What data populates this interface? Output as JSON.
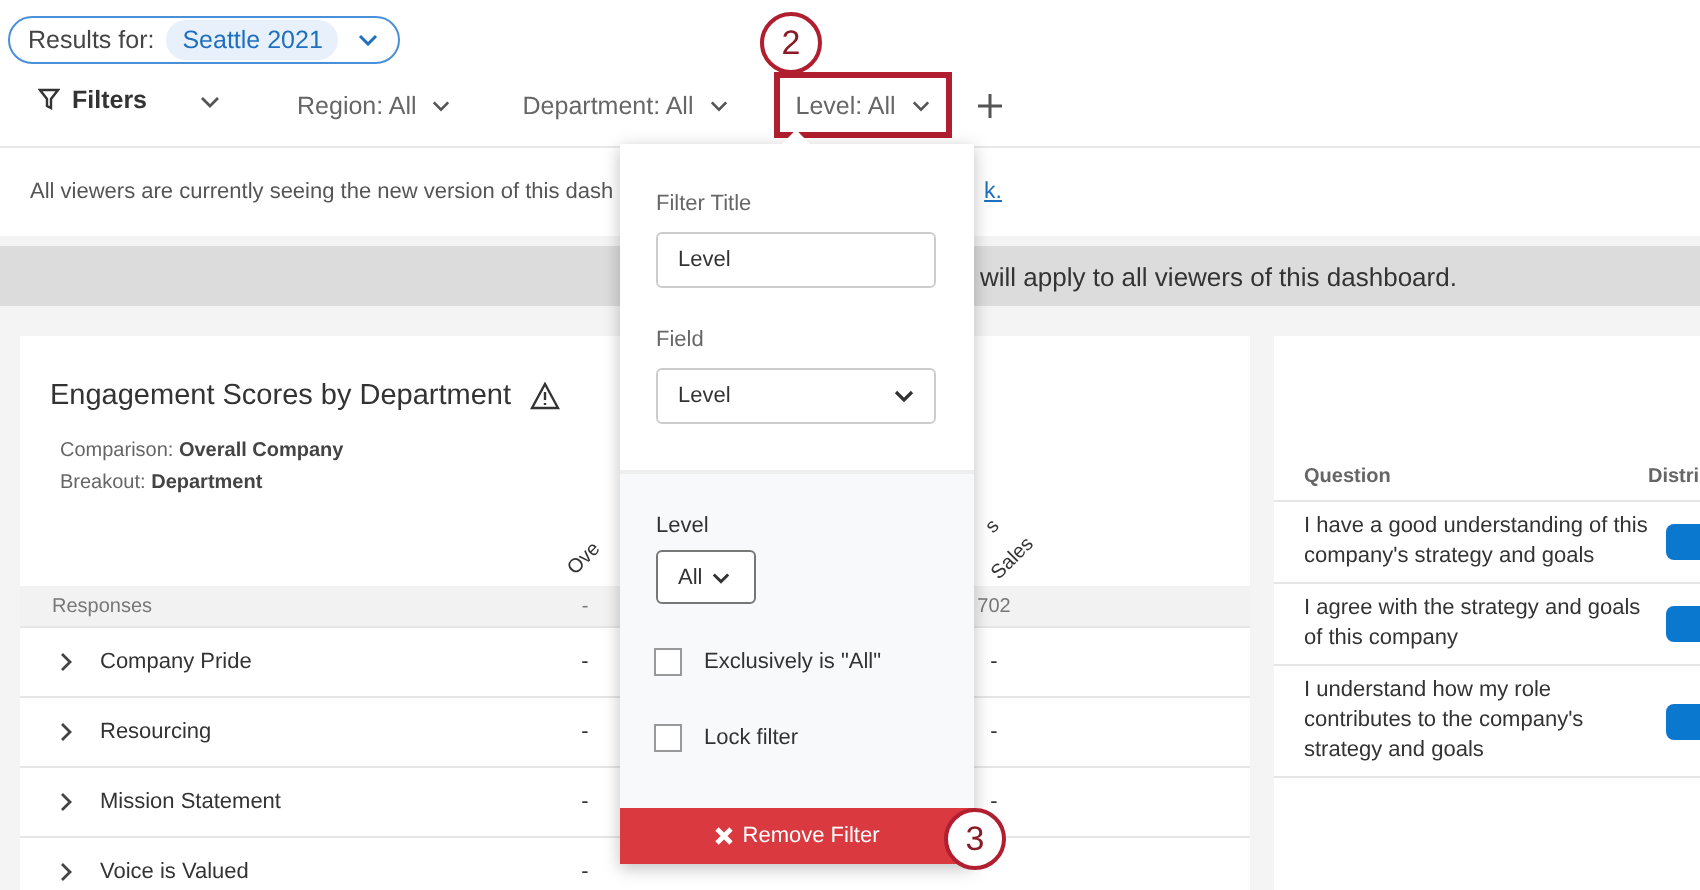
{
  "results_for": {
    "label": "Results for:",
    "value": "Seattle 2021"
  },
  "filters": {
    "label": "Filters",
    "items": [
      {
        "label": "Region: All",
        "selected": false
      },
      {
        "label": "Department: All",
        "selected": false
      },
      {
        "label": "Level: All",
        "selected": true
      }
    ]
  },
  "callouts": [
    "2",
    "3"
  ],
  "notice": {
    "text": "All viewers are currently seeing the new version of this dash",
    "link": "k."
  },
  "banner": "will apply to all viewers of this dashboard.",
  "engagement_card": {
    "title": "Engagement Scores by Department",
    "details": [
      {
        "label": "Comparison:",
        "value": "Overall Company"
      },
      {
        "label": "Breakout:",
        "value": "Department"
      }
    ],
    "columns": [
      "Ove",
      "s",
      "Sales"
    ],
    "header_row": {
      "label": "Responses",
      "cells": [
        "-",
        "702"
      ]
    },
    "rows": [
      {
        "label": "Company Pride",
        "cells": [
          "-",
          "-"
        ]
      },
      {
        "label": "Resourcing",
        "cells": [
          "-",
          "-"
        ]
      },
      {
        "label": "Mission Statement",
        "cells": [
          "-",
          "-"
        ]
      },
      {
        "label": "Voice is Valued",
        "cells": [
          "-"
        ]
      }
    ]
  },
  "questions_card": {
    "columns": [
      "Question",
      "Distri"
    ],
    "rows": [
      {
        "text": "I have a good understanding of this company's strategy and goals"
      },
      {
        "text": "I agree with the strategy and goals of this company"
      },
      {
        "text": "I understand how my role contributes to the company's strategy and goals"
      }
    ]
  },
  "popover": {
    "title_label": "Filter Title",
    "title_value": "Level",
    "field_label": "Field",
    "field_value": "Level",
    "level_label": "Level",
    "level_value": "All",
    "options": [
      {
        "label": "Exclusively is \"All\"",
        "checked": false
      },
      {
        "label": "Lock filter",
        "checked": false
      }
    ],
    "remove_label": "Remove Filter"
  }
}
